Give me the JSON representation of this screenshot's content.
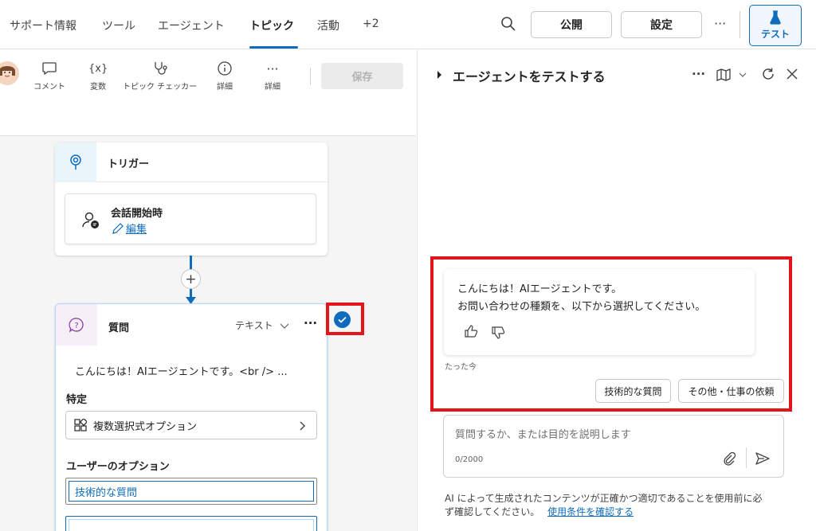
{
  "topnav": {
    "tabs": [
      {
        "label": "サポート情報"
      },
      {
        "label": "ツール"
      },
      {
        "label": "エージェント"
      },
      {
        "label": "トピック"
      },
      {
        "label": "活動"
      },
      {
        "label": "+2"
      }
    ],
    "active_tab": "トピック",
    "publish_label": "公開",
    "settings_label": "設定",
    "test_label": "テスト"
  },
  "toolbar": {
    "comment_label": "コメント",
    "variables_label": "変数",
    "topic_checker_label": "トピック チェッカー",
    "details_label": "詳細",
    "more_label": "詳細",
    "save_label": "保存"
  },
  "trigger": {
    "title": "トリガー",
    "event_label": "会話開始時",
    "edit_label": "編集"
  },
  "question": {
    "title": "質問",
    "type_label": "テキスト",
    "message_preview": "こんにちは！AIエージェントです。<br /> ...",
    "identify_label": "特定",
    "identify_value": "複数選択式オプション",
    "user_options_label": "ユーザーのオプション",
    "options": [
      "技術的な質問",
      ""
    ]
  },
  "test_panel": {
    "title": "エージェントをテストする",
    "message_line1": "こんにちは！AIエージェントです。",
    "message_line2": "お問い合わせの種類を、以下から選択してください。",
    "timestamp": "たった今",
    "chips": [
      "技術的な質問",
      "その他・仕事の依頼"
    ],
    "input_placeholder": "質問するか、または目的を説明します",
    "char_count": "0/2000",
    "disclaimer_line1": "AI によって生成されたコンテンツが正確かつ適切であることを使用前に必",
    "disclaimer_line2": "ず確認してください。",
    "terms_link": "使用条件を確認する"
  },
  "colors": {
    "accent": "#0f6cbd",
    "highlight_red": "#e3151a"
  }
}
